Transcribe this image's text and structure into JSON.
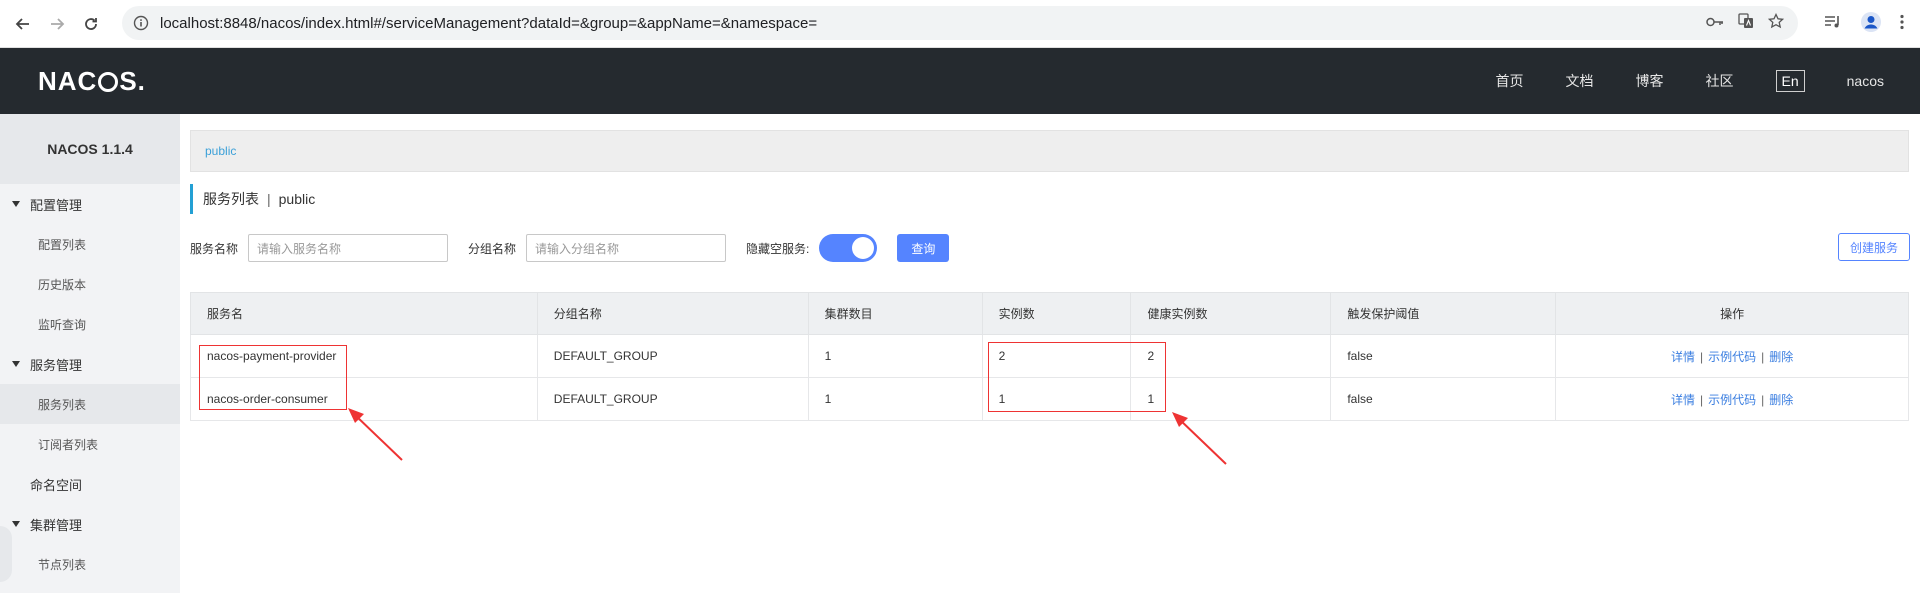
{
  "browser": {
    "url": "localhost:8848/nacos/index.html#/serviceManagement?dataId=&group=&appName=&namespace="
  },
  "header": {
    "logo": "NACOS.",
    "nav": [
      "首页",
      "文档",
      "博客",
      "社区"
    ],
    "lang": "En",
    "user": "nacos"
  },
  "sidebar": {
    "title": "NACOS 1.1.4",
    "groups": [
      {
        "label": "配置管理",
        "items": [
          "配置列表",
          "历史版本",
          "监听查询"
        ]
      },
      {
        "label": "服务管理",
        "items": [
          "服务列表",
          "订阅者列表"
        ]
      }
    ],
    "namespace": "命名空间",
    "cluster": {
      "label": "集群管理",
      "items": [
        "节点列表"
      ]
    }
  },
  "main": {
    "namespace_link": "public",
    "title": "服务列表",
    "title_sep": "|",
    "title_ns": "public",
    "filters": {
      "service_label": "服务名称",
      "service_placeholder": "请输入服务名称",
      "group_label": "分组名称",
      "group_placeholder": "请输入分组名称",
      "hide_empty_label": "隐藏空服务:",
      "hide_empty_on": true,
      "query_button": "查询"
    },
    "create_button": "创建服务",
    "table": {
      "headers": [
        "服务名",
        "分组名称",
        "集群数目",
        "实例数",
        "健康实例数",
        "触发保护阈值",
        "操作"
      ],
      "rows": [
        {
          "name": "nacos-payment-provider",
          "group": "DEFAULT_GROUP",
          "clusters": "1",
          "instances": "2",
          "healthy": "2",
          "threshold": "false"
        },
        {
          "name": "nacos-order-consumer",
          "group": "DEFAULT_GROUP",
          "clusters": "1",
          "instances": "1",
          "healthy": "1",
          "threshold": "false"
        }
      ],
      "ops": {
        "detail": "详情",
        "sample": "示例代码",
        "delete": "删除",
        "sep": "|"
      }
    }
  },
  "colors": {
    "header_bg": "#252a2f",
    "primary": "#5584ff",
    "accent": "#23a0d4",
    "annotation": "#e33333"
  }
}
